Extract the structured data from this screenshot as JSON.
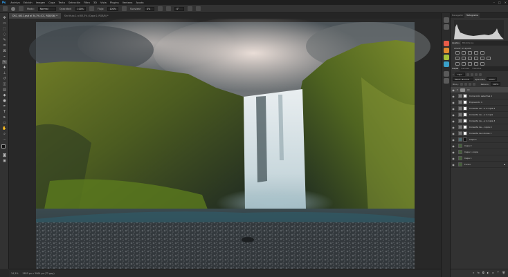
{
  "app": {
    "logo": "Ps"
  },
  "menu": [
    "Archivo",
    "Edición",
    "Imagen",
    "Capa",
    "Texto",
    "Selección",
    "Filtro",
    "3D",
    "Vista",
    "Plugins",
    "Ventana",
    "Ayuda"
  ],
  "options": {
    "mode_label": "Modo:",
    "mode_value": "Normal",
    "opacity_label": "Opacidad:",
    "opacity_value": "100%",
    "flow_label": "Flujo:",
    "flow_value": "100%",
    "smooth_label": "Suavizar:",
    "smooth_value": "0%",
    "angle_value": "0°"
  },
  "tabs": [
    {
      "label": "DSC_6411.psd al 34,3% (CC, RGB/16) *",
      "active": true
    },
    {
      "label": "Sin título-1 al 83,3% (Capa 0, RGB/8) *",
      "active": false
    }
  ],
  "status": {
    "zoom": "34,3%",
    "doc": "5855 px x 3904 px (72 ppp)"
  },
  "panels": {
    "top_tabs": [
      "Navegador",
      "Histograma"
    ],
    "top_active": "Histograma",
    "adjust_tabs": [
      "Ajustes",
      "Bibliotecas"
    ],
    "adjust_active": "Ajustes",
    "adjust_add": "Añadir un ajuste",
    "layer_tabs": [
      "Capas",
      "Canales",
      "Trazados"
    ],
    "layer_active": "Capas",
    "filter_label": "Tipo",
    "blend_value": "Pasar: Normal",
    "opacity_label": "Opacidad:",
    "opacity_value": "100%",
    "lock_label": "Bloq.:",
    "fill_label": "Relleno:",
    "fill_value": "100%",
    "layers": [
      {
        "name": "CC",
        "kind": "folder"
      },
      {
        "name": "Corrección selectiva 1",
        "kind": "adj"
      },
      {
        "name": "Exposición 1",
        "kind": "adj"
      },
      {
        "name": "Consulta de...a 1 copia 2",
        "kind": "adj"
      },
      {
        "name": "Consulta de...a 1 copia",
        "kind": "adj"
      },
      {
        "name": "Consulta de...a 1 copia 3",
        "kind": "adj"
      },
      {
        "name": "Consulta de... copia 4",
        "kind": "adj"
      },
      {
        "name": "Consulta de colores 1",
        "kind": "adj"
      },
      {
        "name": "Capa 3",
        "kind": "pixel"
      },
      {
        "name": "Capa 2",
        "kind": "pixel"
      },
      {
        "name": "Capa 1 copia",
        "kind": "pixel"
      },
      {
        "name": "Capa 1",
        "kind": "pixel"
      },
      {
        "name": "Fondo",
        "kind": "pixel"
      }
    ]
  }
}
